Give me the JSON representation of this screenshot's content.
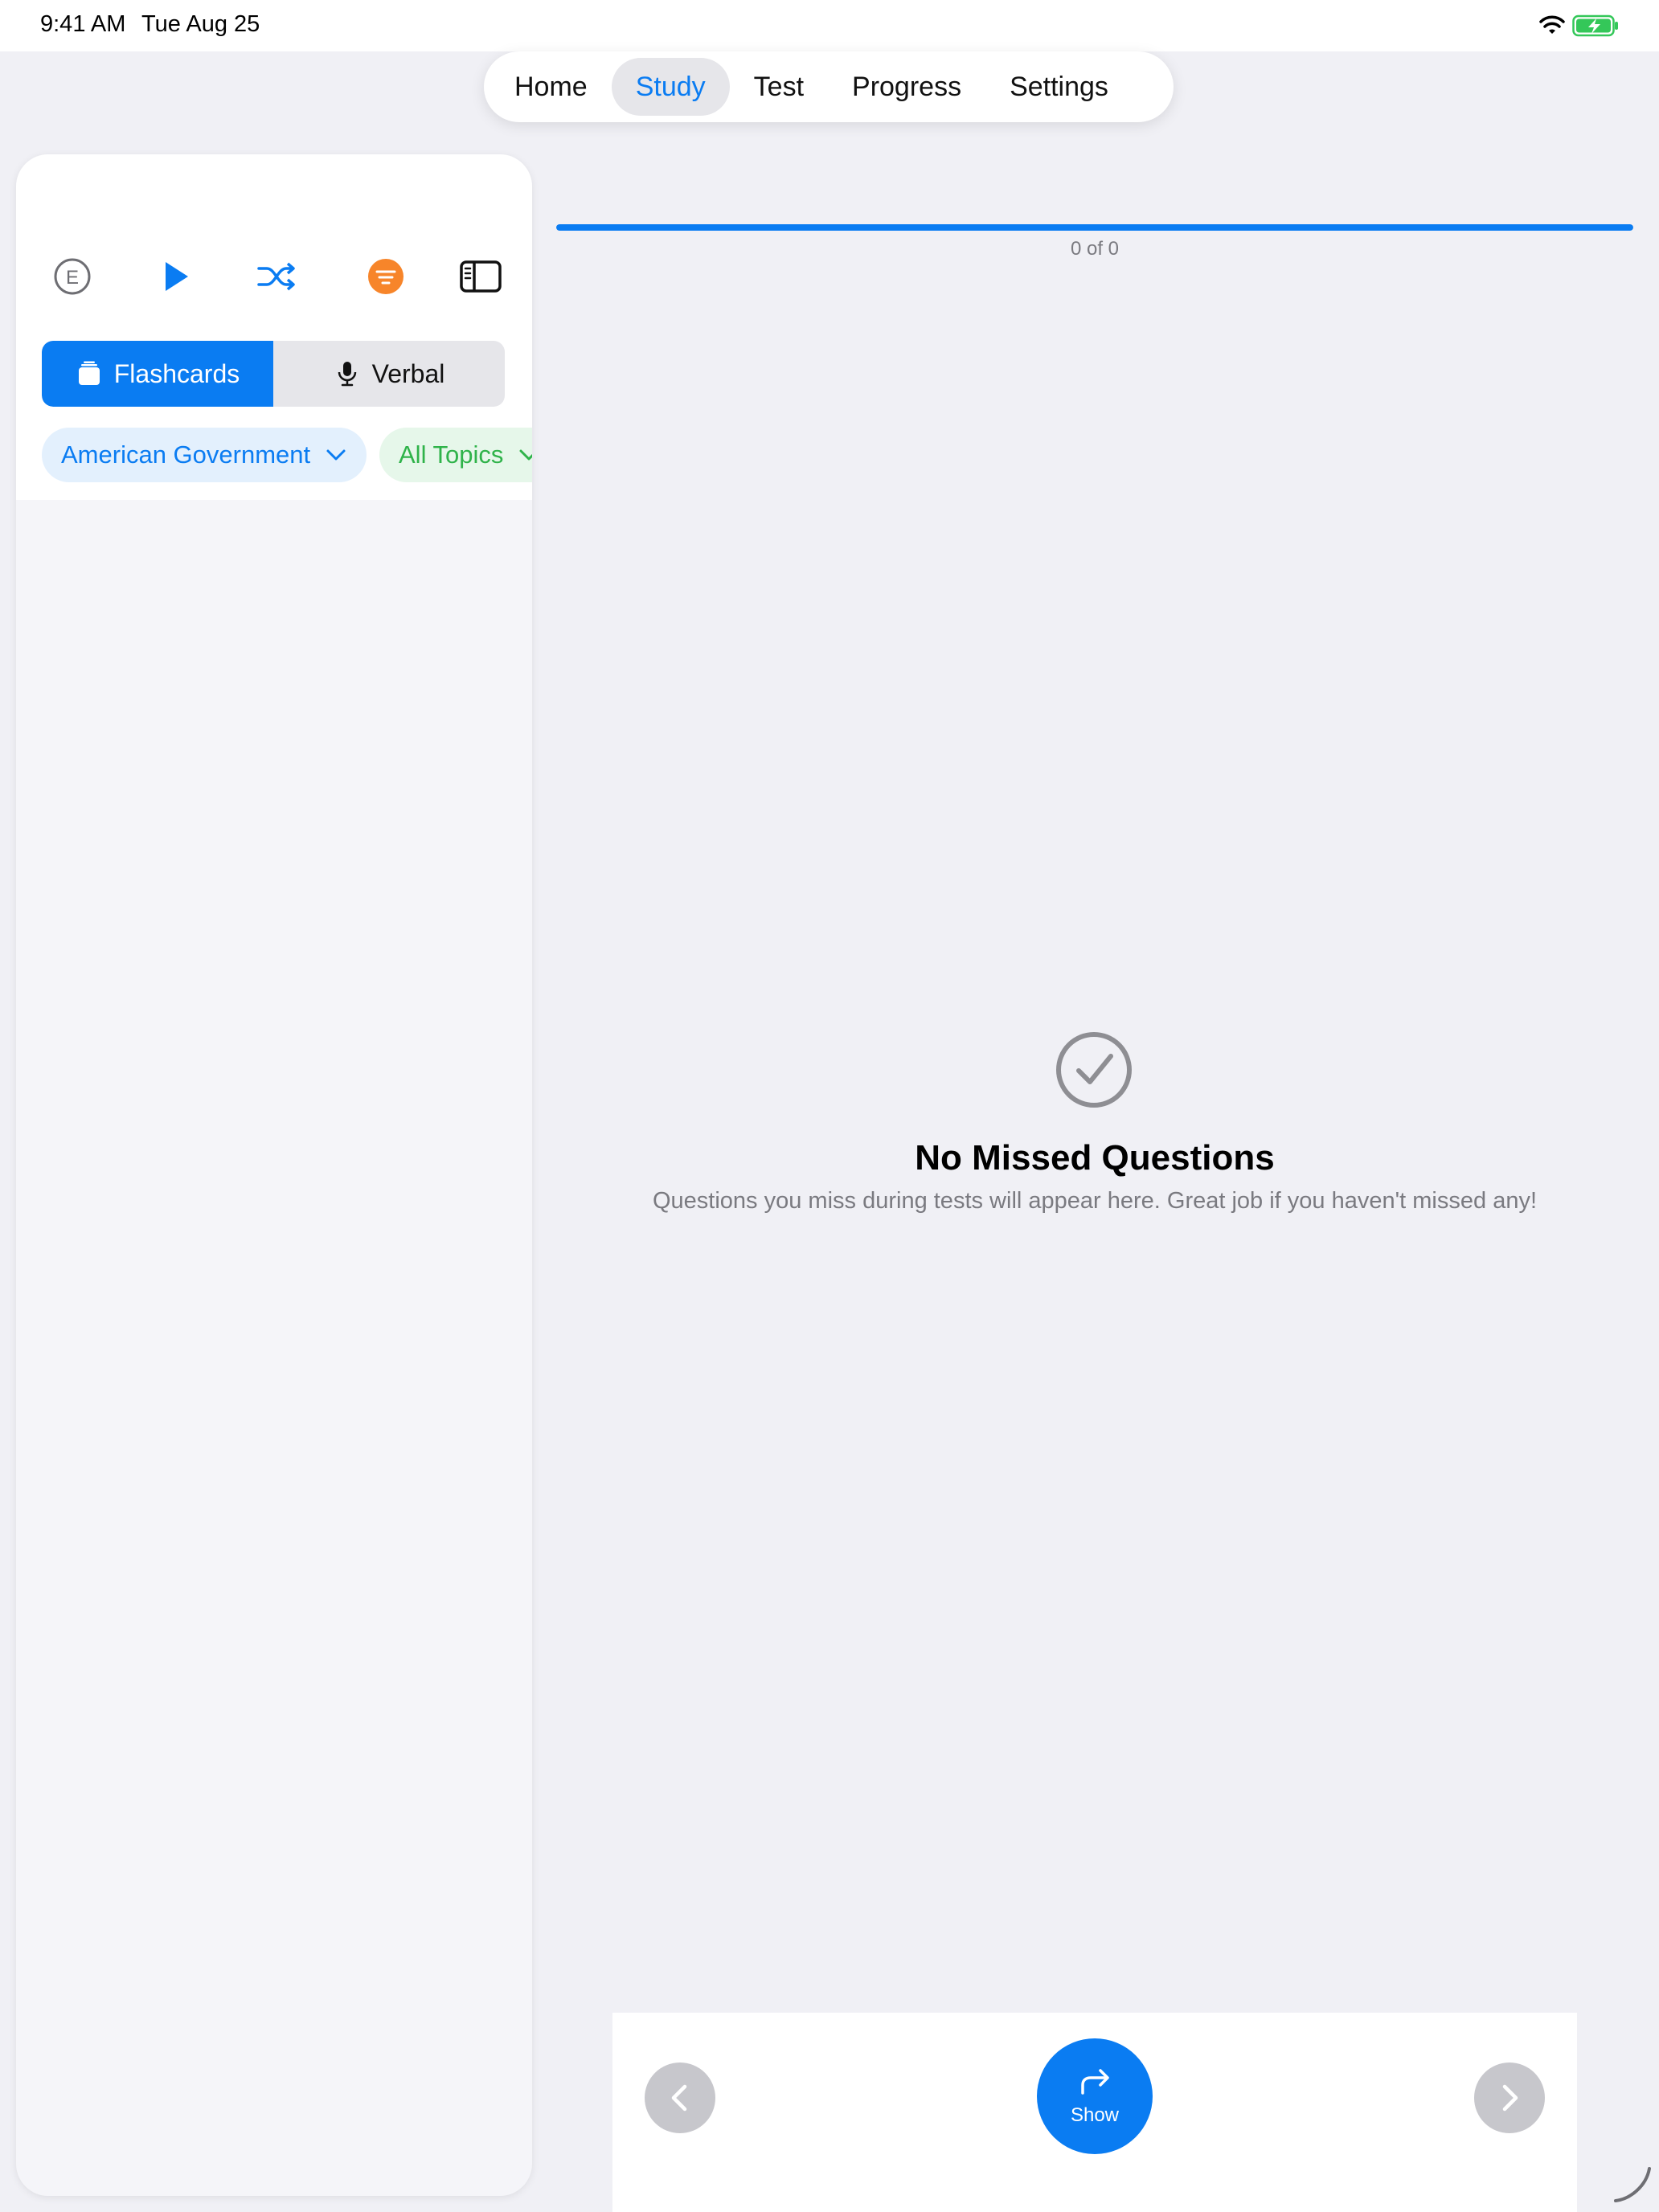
{
  "status_bar": {
    "time": "9:41 AM",
    "date": "Tue Aug 25",
    "icons": [
      "wifi-icon",
      "battery-charging-icon"
    ]
  },
  "tabs": [
    {
      "label": "Home",
      "active": false
    },
    {
      "label": "Study",
      "active": true
    },
    {
      "label": "Test",
      "active": false
    },
    {
      "label": "Progress",
      "active": false
    },
    {
      "label": "Settings",
      "active": false
    }
  ],
  "sidebar": {
    "toolbar_icons": [
      "explicit-e-icon",
      "play-icon",
      "shuffle-icon",
      "filter-icon",
      "sidebar-toggle-icon"
    ],
    "modes": [
      {
        "label": "Flashcards",
        "icon": "cards-icon",
        "active": true
      },
      {
        "label": "Verbal",
        "icon": "microphone-icon",
        "active": false
      }
    ],
    "filters": {
      "subject": "American Government",
      "topics": "All Topics"
    }
  },
  "main": {
    "progress": {
      "label": "0 of 0",
      "fill_fraction": 1.0
    },
    "empty_state": {
      "icon": "checkmark-circle-icon",
      "title": "No Missed Questions",
      "subtitle": "Questions you miss during tests will appear here. Great job if you haven't missed any!"
    }
  },
  "controls": {
    "show_label": "Show",
    "prev_icon": "chevron-left-icon",
    "next_icon": "chevron-right-icon"
  },
  "colors": {
    "accent": "#0a7cf2",
    "filter_orange": "#f7852a",
    "topics_green": "#2fb34a",
    "background": "#f0f0f5"
  }
}
